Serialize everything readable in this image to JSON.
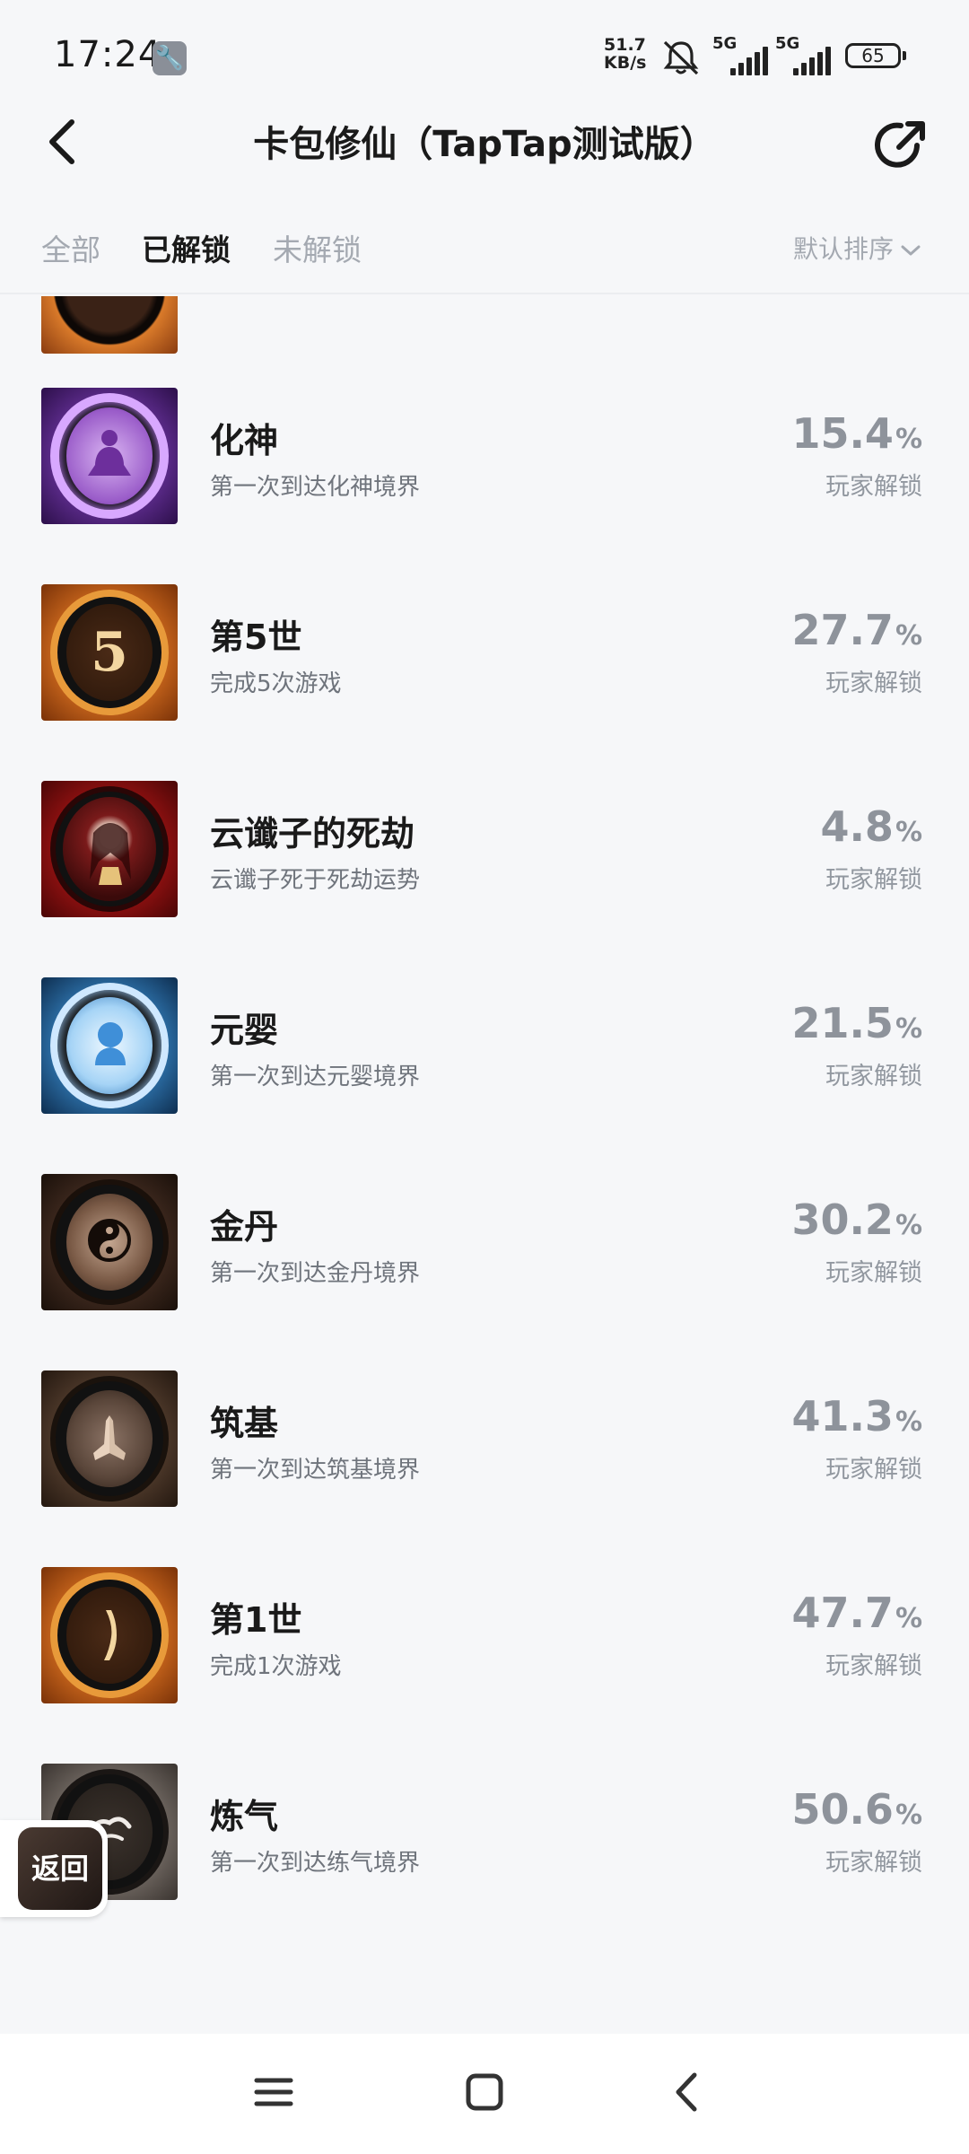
{
  "status_bar": {
    "time": "17:24",
    "net_speed_value": "51.7",
    "net_speed_unit": "KB/s",
    "sim1_label": "5G",
    "sim2_label": "5G",
    "battery": "65"
  },
  "header": {
    "title": "卡包修仙（TapTap测试版）"
  },
  "tabs": {
    "items": [
      "全部",
      "已解锁",
      "未解锁"
    ],
    "active_index": 1,
    "sort_label": "默认排序"
  },
  "achievements": [
    {
      "name": "化神",
      "desc": "第一次到达化神境界",
      "percent": "15.4",
      "unit": "%",
      "label": "玩家解锁",
      "icon": "meditation-figure-icon",
      "theme": "purple"
    },
    {
      "name": "第5世",
      "desc": "完成5次游戏",
      "percent": "27.7",
      "unit": "%",
      "label": "玩家解锁",
      "icon": "number-five-icon",
      "theme": "orange"
    },
    {
      "name": "云谶子的死劫",
      "desc": "云谶子死于死劫运势",
      "percent": "4.8",
      "unit": "%",
      "label": "玩家解锁",
      "icon": "character-portrait-icon",
      "theme": "red"
    },
    {
      "name": "元婴",
      "desc": "第一次到达元婴境界",
      "percent": "21.5",
      "unit": "%",
      "label": "玩家解锁",
      "icon": "infant-spirit-icon",
      "theme": "blue"
    },
    {
      "name": "金丹",
      "desc": "第一次到达金丹境界",
      "percent": "30.2",
      "unit": "%",
      "label": "玩家解锁",
      "icon": "taiji-icon",
      "theme": "brown"
    },
    {
      "name": "筑基",
      "desc": "第一次到达筑基境界",
      "percent": "41.3",
      "unit": "%",
      "label": "玩家解锁",
      "icon": "praying-hands-icon",
      "theme": "tan"
    },
    {
      "name": "第1世",
      "desc": "完成1次游戏",
      "percent": "47.7",
      "unit": "%",
      "label": "玩家解锁",
      "icon": "number-one-icon",
      "theme": "orange"
    },
    {
      "name": "炼气",
      "desc": "第一次到达练气境界",
      "percent": "50.6",
      "unit": "%",
      "label": "玩家解锁",
      "icon": "cloud-swirl-icon",
      "theme": "grey"
    }
  ],
  "floating": {
    "return_label": "返回"
  },
  "colors": {
    "background": "#f6f7f9",
    "text_primary": "#1a1a1a",
    "text_secondary": "#6f747c",
    "text_muted": "#8e939b",
    "tab_inactive": "#a4a9b1"
  }
}
